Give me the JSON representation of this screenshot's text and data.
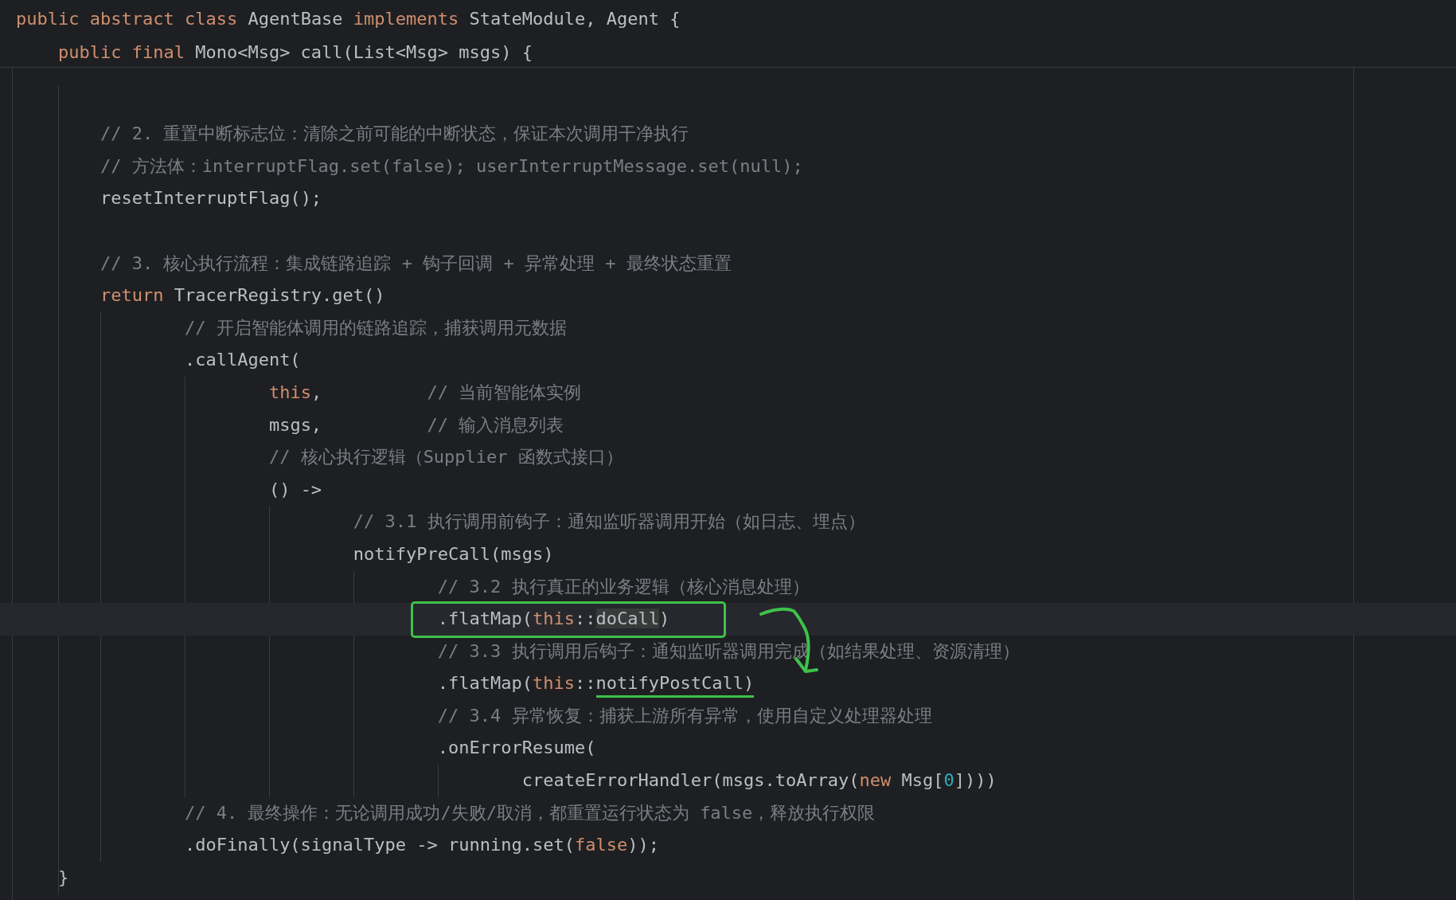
{
  "sticky_header": [
    {
      "tokens": [
        {
          "kind": "keyword",
          "text": "public abstract class "
        },
        {
          "kind": "plain",
          "text": "AgentBase "
        },
        {
          "kind": "keyword",
          "text": "implements "
        },
        {
          "kind": "plain",
          "text": "StateModule, Agent {"
        }
      ]
    },
    {
      "tokens": [
        {
          "kind": "keyword",
          "text": "    public final "
        },
        {
          "kind": "plain",
          "text": "Mono<Msg> call(List<Msg> msgs) {"
        }
      ]
    }
  ],
  "lines": [
    {
      "current": false,
      "boxed": false
    },
    {
      "current": false,
      "boxed": false,
      "tokens": [
        {
          "kind": "comment",
          "text": "        // 2. 重置中断标志位：清除之前可能的中断状态，保证本次调用干净执行"
        }
      ]
    },
    {
      "current": false,
      "boxed": false,
      "tokens": [
        {
          "kind": "comment",
          "text": "        // 方法体：interruptFlag.set(false); userInterruptMessage.set(null);"
        }
      ]
    },
    {
      "current": false,
      "boxed": false,
      "tokens": [
        {
          "kind": "plain",
          "text": "        resetInterruptFlag();"
        }
      ]
    },
    {
      "current": false,
      "boxed": false
    },
    {
      "current": false,
      "boxed": false,
      "tokens": [
        {
          "kind": "comment",
          "text": "        // 3. 核心执行流程：集成链路追踪 + 钩子回调 + 异常处理 + 最终状态重置"
        }
      ]
    },
    {
      "current": false,
      "boxed": false,
      "tokens": [
        {
          "kind": "keyword",
          "text": "        return "
        },
        {
          "kind": "plain",
          "text": "TracerRegistry.get()"
        }
      ]
    },
    {
      "current": false,
      "boxed": false,
      "tokens": [
        {
          "kind": "comment",
          "text": "                // 开启智能体调用的链路追踪，捕获调用元数据"
        }
      ]
    },
    {
      "current": false,
      "boxed": false,
      "tokens": [
        {
          "kind": "plain",
          "text": "                .callAgent("
        }
      ]
    },
    {
      "current": false,
      "boxed": false,
      "tokens": [
        {
          "kind": "keyword",
          "text": "                        this"
        },
        {
          "kind": "plain",
          "text": ",          "
        },
        {
          "kind": "comment",
          "text": "// 当前智能体实例"
        }
      ]
    },
    {
      "current": false,
      "boxed": false,
      "tokens": [
        {
          "kind": "plain",
          "text": "                        msgs,          "
        },
        {
          "kind": "comment",
          "text": "// 输入消息列表"
        }
      ]
    },
    {
      "current": false,
      "boxed": false,
      "tokens": [
        {
          "kind": "comment",
          "text": "                        // 核心执行逻辑（Supplier 函数式接口）"
        }
      ]
    },
    {
      "current": false,
      "boxed": false,
      "tokens": [
        {
          "kind": "plain",
          "text": "                        () ->"
        }
      ]
    },
    {
      "current": false,
      "boxed": false,
      "tokens": [
        {
          "kind": "comment",
          "text": "                                // 3.1 执行调用前钩子：通知监听器调用开始（如日志、埋点）"
        }
      ]
    },
    {
      "current": false,
      "boxed": false,
      "tokens": [
        {
          "kind": "plain",
          "text": "                                notifyPreCall(msgs)"
        }
      ]
    },
    {
      "current": false,
      "boxed": false,
      "tokens": [
        {
          "kind": "comment",
          "text": "                                        // 3.2 执行真正的业务逻辑（核心消息处理）"
        }
      ]
    },
    {
      "current": true,
      "boxed": true,
      "tokens": [
        {
          "kind": "plain",
          "text": "                                        .flatMap("
        },
        {
          "kind": "keyword",
          "text": "this"
        },
        {
          "kind": "plain",
          "text": "::"
        },
        {
          "kind": "plain",
          "text": "doCall",
          "occurrence": true
        },
        {
          "kind": "plain",
          "text": ")"
        }
      ]
    },
    {
      "current": false,
      "boxed": false,
      "tokens": [
        {
          "kind": "comment",
          "text": "                                        // 3.3 执行调用后钩子：通知监听器调用完成（如结果处理、资源清理）"
        }
      ]
    },
    {
      "current": false,
      "boxed": false,
      "tokens": [
        {
          "kind": "plain",
          "text": "                                        .flatMap("
        },
        {
          "kind": "keyword",
          "text": "this"
        },
        {
          "kind": "plain",
          "text": "::"
        },
        {
          "kind": "plain",
          "text": "notifyPostCall)",
          "underlined": true
        }
      ]
    },
    {
      "current": false,
      "boxed": false,
      "tokens": [
        {
          "kind": "comment",
          "text": "                                        // 3.4 异常恢复：捕获上游所有异常，使用自定义处理器处理"
        }
      ]
    },
    {
      "current": false,
      "boxed": false,
      "tokens": [
        {
          "kind": "plain",
          "text": "                                        .onErrorResume("
        }
      ]
    },
    {
      "current": false,
      "boxed": false,
      "tokens": [
        {
          "kind": "plain",
          "text": "                                                createErrorHandler(msgs.toArray("
        },
        {
          "kind": "keyword",
          "text": "new "
        },
        {
          "kind": "plain",
          "text": "Msg["
        },
        {
          "kind": "number",
          "text": "0"
        },
        {
          "kind": "plain",
          "text": "])))"
        }
      ]
    },
    {
      "current": false,
      "boxed": false,
      "tokens": [
        {
          "kind": "comment",
          "text": "                // 4. 最终操作：无论调用成功/失败/取消，都重置运行状态为 false，释放执行权限"
        }
      ]
    },
    {
      "current": false,
      "boxed": false,
      "tokens": [
        {
          "kind": "plain",
          "text": "                .doFinally(signalType -> running.set("
        },
        {
          "kind": "keyword",
          "text": "false"
        },
        {
          "kind": "plain",
          "text": "));"
        }
      ]
    },
    {
      "current": false,
      "boxed": false,
      "tokens": [
        {
          "kind": "plain",
          "text": "    }"
        }
      ]
    }
  ]
}
